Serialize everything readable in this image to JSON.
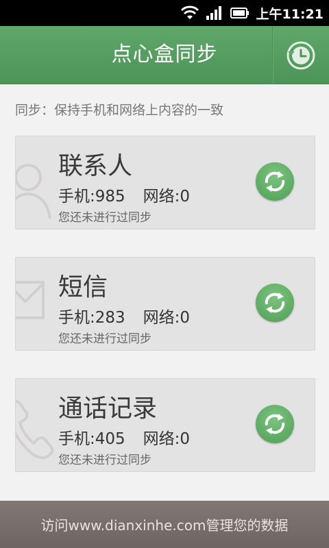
{
  "status_bar": {
    "time": "上午11:21",
    "icons": [
      "wifi-icon",
      "signal-icon",
      "battery-icon"
    ]
  },
  "header": {
    "title": "点心盒同步",
    "history_icon": "history-icon"
  },
  "subtitle": "同步：保持手机和网络上内容的一致",
  "cards": [
    {
      "name": "联系人",
      "phone_count": "手机:985",
      "network_count": "网络:0",
      "status": "您还未进行过同步",
      "icon": "contact-icon"
    },
    {
      "name": "短信",
      "phone_count": "手机:283",
      "network_count": "网络:0",
      "status": "您还未进行过同步",
      "icon": "envelope-icon"
    },
    {
      "name": "通话记录",
      "phone_count": "手机:405",
      "network_count": "网络:0",
      "status": "您还未进行过同步",
      "icon": "phone-icon"
    }
  ],
  "footer": {
    "text": "访问www.dianxinhe.com管理您的数据"
  },
  "colors": {
    "header_green": "#4c9457",
    "sync_green": "#5aa862",
    "footer": "#766d6b"
  }
}
